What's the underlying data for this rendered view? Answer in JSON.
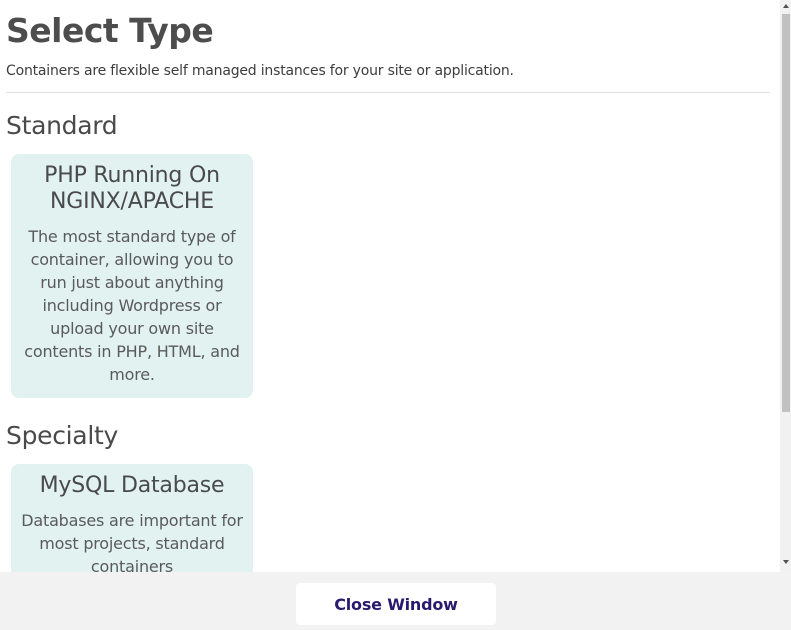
{
  "header": {
    "title": "Select Type",
    "subtitle": "Containers are flexible self managed instances for your site or application."
  },
  "sections": [
    {
      "heading": "Standard",
      "cards": [
        {
          "title": "PHP Running On NGINX/APACHE",
          "description": "The most standard type of container, allowing you to run just about anything including Wordpress or upload your own site contents in PHP, HTML, and more."
        }
      ]
    },
    {
      "heading": "Specialty",
      "cards": [
        {
          "title": "MySQL Database",
          "description": "Databases are important for most projects, standard containers"
        }
      ]
    }
  ],
  "footer": {
    "close_label": "Close Window"
  },
  "colors": {
    "card_background": "#e1f2f1",
    "button_text": "#2a1a6e",
    "footer_background": "#f2f2f2"
  }
}
